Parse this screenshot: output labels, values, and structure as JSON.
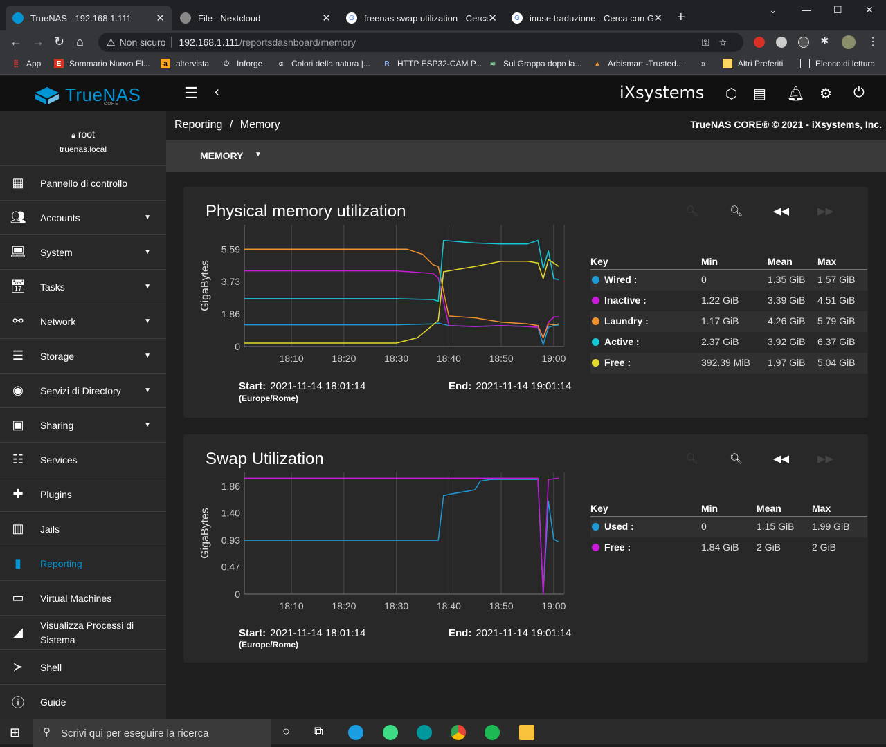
{
  "browser": {
    "tabs": [
      {
        "title": "TrueNAS - 192.168.1.111",
        "active": true
      },
      {
        "title": "File - Nextcloud"
      },
      {
        "title": "freenas swap utilization - Cerca c"
      },
      {
        "title": "inuse traduzione - Cerca con Goo"
      }
    ],
    "url_warning": "Non sicuro",
    "url_host": "192.168.1.111",
    "url_path": "/reportsdashboard/memory",
    "bookmarks": [
      "App",
      "Sommario Nuova El...",
      "altervista",
      "Inforge",
      "Colori della natura |...",
      "HTTP ESP32-CAM P...",
      "Sul Grappa dopo la...",
      "Arbismart -Trusted..."
    ],
    "bookmarks_more": "»",
    "other_bookmarks": "Altri Preferiti",
    "reading_list": "Elenco di lettura"
  },
  "app": {
    "brand": "TrueNAS",
    "brand_sub": "CORE",
    "vendor": "iXsystems",
    "user": "root",
    "hostname": "truenas.local"
  },
  "sidebar": {
    "items": [
      {
        "label": "Pannello di controllo",
        "icon": "dashboard-icon",
        "caret": false
      },
      {
        "label": "Accounts",
        "icon": "people-icon",
        "caret": true
      },
      {
        "label": "System",
        "icon": "laptop-icon",
        "caret": true
      },
      {
        "label": "Tasks",
        "icon": "calendar-icon",
        "caret": true
      },
      {
        "label": "Network",
        "icon": "network-icon",
        "caret": true
      },
      {
        "label": "Storage",
        "icon": "storage-icon",
        "caret": true
      },
      {
        "label": "Servizi di Directory",
        "icon": "directory-icon",
        "caret": true
      },
      {
        "label": "Sharing",
        "icon": "folder-shared-icon",
        "caret": true
      },
      {
        "label": "Services",
        "icon": "tune-icon",
        "caret": false
      },
      {
        "label": "Plugins",
        "icon": "puzzle-icon",
        "caret": false
      },
      {
        "label": "Jails",
        "icon": "jail-icon",
        "caret": false
      },
      {
        "label": "Reporting",
        "icon": "chart-icon",
        "caret": false,
        "active": true
      },
      {
        "label": "Virtual Machines",
        "icon": "computer-icon",
        "caret": false
      },
      {
        "label": "Visualizza Processi di Sistema",
        "icon": "process-icon",
        "caret": false
      },
      {
        "label": "Shell",
        "icon": "terminal-icon",
        "caret": false
      },
      {
        "label": "Guide",
        "icon": "info-icon",
        "caret": false
      }
    ]
  },
  "main": {
    "breadcrumb_parent": "Reporting",
    "breadcrumb_sep": "/",
    "breadcrumb_current": "Memory",
    "copyright": "TrueNAS CORE® © 2021 - iXsystems, Inc.",
    "report_select": "MEMORY"
  },
  "charts": [
    {
      "title": "Physical memory utilization",
      "start_label": "Start:",
      "start": "2021-11-14 18:01:14",
      "end_label": "End:",
      "end": "2021-11-14 19:01:14",
      "timezone": "(Europe/Rome)",
      "legend": {
        "headers": [
          "Key",
          "Min",
          "Mean",
          "Max"
        ],
        "rows": [
          {
            "name": "Wired :",
            "min": "0",
            "mean": "1.35 GiB",
            "max": "1.57 GiB",
            "color": "#1e9bd7"
          },
          {
            "name": "Inactive :",
            "min": "1.22 GiB",
            "mean": "3.39 GiB",
            "max": "4.51 GiB",
            "color": "#c71bd7"
          },
          {
            "name": "Laundry :",
            "min": "1.17 GiB",
            "mean": "4.26 GiB",
            "max": "5.79 GiB",
            "color": "#f0912e"
          },
          {
            "name": "Active :",
            "min": "2.37 GiB",
            "mean": "3.92 GiB",
            "max": "6.37 GiB",
            "color": "#13c9d6"
          },
          {
            "name": "Free :",
            "min": "392.39 MiB",
            "mean": "1.97 GiB",
            "max": "5.04 GiB",
            "color": "#e4d82c"
          }
        ]
      }
    },
    {
      "title": "Swap Utilization",
      "start_label": "Start:",
      "start": "2021-11-14 18:01:14",
      "end_label": "End:",
      "end": "2021-11-14 19:01:14",
      "timezone": "(Europe/Rome)",
      "legend": {
        "headers": [
          "Key",
          "Min",
          "Mean",
          "Max"
        ],
        "rows": [
          {
            "name": "Used :",
            "min": "0",
            "mean": "1.15 GiB",
            "max": "1.99 GiB",
            "color": "#1e9bd7"
          },
          {
            "name": "Free :",
            "min": "1.84 GiB",
            "mean": "2 GiB",
            "max": "2 GiB",
            "color": "#c71bd7"
          }
        ]
      }
    }
  ],
  "chart_data": [
    {
      "type": "line",
      "title": "Physical memory utilization",
      "ylabel": "GigaBytes",
      "yticks": [
        "0",
        "1.86",
        "3.73",
        "5.59"
      ],
      "xticks": [
        "18:10",
        "18:20",
        "18:30",
        "18:40",
        "18:50",
        "19:00"
      ],
      "ylim": [
        0,
        7.0
      ],
      "xlim": [
        "18:01",
        "19:02"
      ],
      "series": [
        {
          "name": "Wired",
          "color": "#1e9bd7",
          "x": [
            "18:01",
            "18:30",
            "18:37",
            "18:38",
            "18:40",
            "18:45",
            "18:50",
            "18:55",
            "18:57",
            "18:58",
            "18:59",
            "19:00",
            "19:01"
          ],
          "y": [
            1.25,
            1.25,
            1.3,
            1.35,
            1.2,
            1.15,
            1.2,
            1.15,
            1.1,
            0.1,
            1.1,
            1.2,
            1.25
          ]
        },
        {
          "name": "Inactive",
          "color": "#c71bd7",
          "x": [
            "18:01",
            "18:30",
            "18:37",
            "18:38",
            "18:40",
            "18:45",
            "18:50",
            "18:55",
            "18:57",
            "18:58",
            "18:59",
            "19:00",
            "19:01"
          ],
          "y": [
            4.35,
            4.35,
            4.2,
            3.95,
            1.2,
            1.15,
            1.2,
            1.15,
            1.1,
            0.5,
            1.4,
            1.7,
            1.7
          ]
        },
        {
          "name": "Laundry",
          "color": "#f0912e",
          "x": [
            "18:01",
            "18:32",
            "18:35",
            "18:37",
            "18:38",
            "18:40",
            "18:45",
            "18:50",
            "18:55",
            "18:57",
            "18:58",
            "18:59",
            "19:00",
            "19:01"
          ],
          "y": [
            5.6,
            5.6,
            5.3,
            4.7,
            4.6,
            1.75,
            1.65,
            1.4,
            1.3,
            1.2,
            0.5,
            1.3,
            1.25,
            1.3
          ]
        },
        {
          "name": "Active",
          "color": "#13c9d6",
          "x": [
            "18:01",
            "18:30",
            "18:37",
            "18:38",
            "18:39",
            "18:45",
            "18:50",
            "18:55",
            "18:57",
            "18:58",
            "18:59",
            "19:00",
            "19:01"
          ],
          "y": [
            2.75,
            2.75,
            2.7,
            2.6,
            6.1,
            5.95,
            5.9,
            5.9,
            6.1,
            4.5,
            5.5,
            3.9,
            3.85
          ]
        },
        {
          "name": "Free",
          "color": "#e4d82c",
          "x": [
            "18:01",
            "18:30",
            "18:34",
            "18:36",
            "18:38",
            "18:39",
            "18:45",
            "18:50",
            "18:55",
            "18:57",
            "18:58",
            "18:59",
            "19:00",
            "19:01"
          ],
          "y": [
            0.2,
            0.2,
            0.5,
            1.0,
            1.5,
            4.3,
            4.6,
            4.9,
            4.9,
            4.8,
            3.9,
            5.0,
            4.8,
            4.6
          ]
        }
      ]
    },
    {
      "type": "line",
      "title": "Swap Utilization",
      "ylabel": "GigaBytes",
      "yticks": [
        "0",
        "0.47",
        "0.93",
        "1.40",
        "1.86"
      ],
      "xticks": [
        "18:10",
        "18:20",
        "18:30",
        "18:40",
        "18:50",
        "19:00"
      ],
      "ylim": [
        0,
        2.1
      ],
      "xlim": [
        "18:01",
        "19:02"
      ],
      "series": [
        {
          "name": "Used",
          "color": "#1e9bd7",
          "x": [
            "18:01",
            "18:38",
            "18:39",
            "18:40",
            "18:45",
            "18:46",
            "18:48",
            "18:57",
            "18:58",
            "18:59",
            "19:00",
            "19:01"
          ],
          "y": [
            0.93,
            0.93,
            1.7,
            1.72,
            1.8,
            1.95,
            1.98,
            1.98,
            0.0,
            1.6,
            0.95,
            0.9
          ]
        },
        {
          "name": "Free",
          "color": "#c71bd7",
          "x": [
            "18:01",
            "18:57",
            "18:58",
            "18:59",
            "19:01"
          ],
          "y": [
            2.0,
            2.0,
            0.0,
            1.98,
            2.0
          ]
        }
      ]
    }
  ]
}
